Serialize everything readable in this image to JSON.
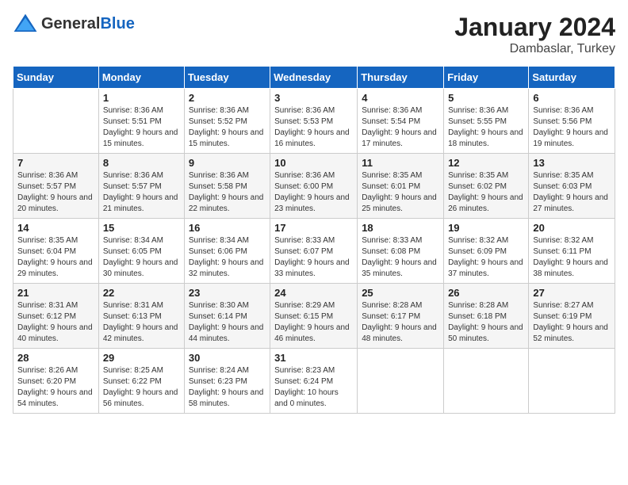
{
  "header": {
    "logo_general": "General",
    "logo_blue": "Blue",
    "month_title": "January 2024",
    "location": "Dambaslar, Turkey"
  },
  "days_of_week": [
    "Sunday",
    "Monday",
    "Tuesday",
    "Wednesday",
    "Thursday",
    "Friday",
    "Saturday"
  ],
  "weeks": [
    [
      {
        "day": "",
        "sunrise": "",
        "sunset": "",
        "daylight": ""
      },
      {
        "day": "1",
        "sunrise": "Sunrise: 8:36 AM",
        "sunset": "Sunset: 5:51 PM",
        "daylight": "Daylight: 9 hours and 15 minutes."
      },
      {
        "day": "2",
        "sunrise": "Sunrise: 8:36 AM",
        "sunset": "Sunset: 5:52 PM",
        "daylight": "Daylight: 9 hours and 15 minutes."
      },
      {
        "day": "3",
        "sunrise": "Sunrise: 8:36 AM",
        "sunset": "Sunset: 5:53 PM",
        "daylight": "Daylight: 9 hours and 16 minutes."
      },
      {
        "day": "4",
        "sunrise": "Sunrise: 8:36 AM",
        "sunset": "Sunset: 5:54 PM",
        "daylight": "Daylight: 9 hours and 17 minutes."
      },
      {
        "day": "5",
        "sunrise": "Sunrise: 8:36 AM",
        "sunset": "Sunset: 5:55 PM",
        "daylight": "Daylight: 9 hours and 18 minutes."
      },
      {
        "day": "6",
        "sunrise": "Sunrise: 8:36 AM",
        "sunset": "Sunset: 5:56 PM",
        "daylight": "Daylight: 9 hours and 19 minutes."
      }
    ],
    [
      {
        "day": "7",
        "sunrise": "Sunrise: 8:36 AM",
        "sunset": "Sunset: 5:57 PM",
        "daylight": "Daylight: 9 hours and 20 minutes."
      },
      {
        "day": "8",
        "sunrise": "Sunrise: 8:36 AM",
        "sunset": "Sunset: 5:57 PM",
        "daylight": "Daylight: 9 hours and 21 minutes."
      },
      {
        "day": "9",
        "sunrise": "Sunrise: 8:36 AM",
        "sunset": "Sunset: 5:58 PM",
        "daylight": "Daylight: 9 hours and 22 minutes."
      },
      {
        "day": "10",
        "sunrise": "Sunrise: 8:36 AM",
        "sunset": "Sunset: 6:00 PM",
        "daylight": "Daylight: 9 hours and 23 minutes."
      },
      {
        "day": "11",
        "sunrise": "Sunrise: 8:35 AM",
        "sunset": "Sunset: 6:01 PM",
        "daylight": "Daylight: 9 hours and 25 minutes."
      },
      {
        "day": "12",
        "sunrise": "Sunrise: 8:35 AM",
        "sunset": "Sunset: 6:02 PM",
        "daylight": "Daylight: 9 hours and 26 minutes."
      },
      {
        "day": "13",
        "sunrise": "Sunrise: 8:35 AM",
        "sunset": "Sunset: 6:03 PM",
        "daylight": "Daylight: 9 hours and 27 minutes."
      }
    ],
    [
      {
        "day": "14",
        "sunrise": "Sunrise: 8:35 AM",
        "sunset": "Sunset: 6:04 PM",
        "daylight": "Daylight: 9 hours and 29 minutes."
      },
      {
        "day": "15",
        "sunrise": "Sunrise: 8:34 AM",
        "sunset": "Sunset: 6:05 PM",
        "daylight": "Daylight: 9 hours and 30 minutes."
      },
      {
        "day": "16",
        "sunrise": "Sunrise: 8:34 AM",
        "sunset": "Sunset: 6:06 PM",
        "daylight": "Daylight: 9 hours and 32 minutes."
      },
      {
        "day": "17",
        "sunrise": "Sunrise: 8:33 AM",
        "sunset": "Sunset: 6:07 PM",
        "daylight": "Daylight: 9 hours and 33 minutes."
      },
      {
        "day": "18",
        "sunrise": "Sunrise: 8:33 AM",
        "sunset": "Sunset: 6:08 PM",
        "daylight": "Daylight: 9 hours and 35 minutes."
      },
      {
        "day": "19",
        "sunrise": "Sunrise: 8:32 AM",
        "sunset": "Sunset: 6:09 PM",
        "daylight": "Daylight: 9 hours and 37 minutes."
      },
      {
        "day": "20",
        "sunrise": "Sunrise: 8:32 AM",
        "sunset": "Sunset: 6:11 PM",
        "daylight": "Daylight: 9 hours and 38 minutes."
      }
    ],
    [
      {
        "day": "21",
        "sunrise": "Sunrise: 8:31 AM",
        "sunset": "Sunset: 6:12 PM",
        "daylight": "Daylight: 9 hours and 40 minutes."
      },
      {
        "day": "22",
        "sunrise": "Sunrise: 8:31 AM",
        "sunset": "Sunset: 6:13 PM",
        "daylight": "Daylight: 9 hours and 42 minutes."
      },
      {
        "day": "23",
        "sunrise": "Sunrise: 8:30 AM",
        "sunset": "Sunset: 6:14 PM",
        "daylight": "Daylight: 9 hours and 44 minutes."
      },
      {
        "day": "24",
        "sunrise": "Sunrise: 8:29 AM",
        "sunset": "Sunset: 6:15 PM",
        "daylight": "Daylight: 9 hours and 46 minutes."
      },
      {
        "day": "25",
        "sunrise": "Sunrise: 8:28 AM",
        "sunset": "Sunset: 6:17 PM",
        "daylight": "Daylight: 9 hours and 48 minutes."
      },
      {
        "day": "26",
        "sunrise": "Sunrise: 8:28 AM",
        "sunset": "Sunset: 6:18 PM",
        "daylight": "Daylight: 9 hours and 50 minutes."
      },
      {
        "day": "27",
        "sunrise": "Sunrise: 8:27 AM",
        "sunset": "Sunset: 6:19 PM",
        "daylight": "Daylight: 9 hours and 52 minutes."
      }
    ],
    [
      {
        "day": "28",
        "sunrise": "Sunrise: 8:26 AM",
        "sunset": "Sunset: 6:20 PM",
        "daylight": "Daylight: 9 hours and 54 minutes."
      },
      {
        "day": "29",
        "sunrise": "Sunrise: 8:25 AM",
        "sunset": "Sunset: 6:22 PM",
        "daylight": "Daylight: 9 hours and 56 minutes."
      },
      {
        "day": "30",
        "sunrise": "Sunrise: 8:24 AM",
        "sunset": "Sunset: 6:23 PM",
        "daylight": "Daylight: 9 hours and 58 minutes."
      },
      {
        "day": "31",
        "sunrise": "Sunrise: 8:23 AM",
        "sunset": "Sunset: 6:24 PM",
        "daylight": "Daylight: 10 hours and 0 minutes."
      },
      {
        "day": "",
        "sunrise": "",
        "sunset": "",
        "daylight": ""
      },
      {
        "day": "",
        "sunrise": "",
        "sunset": "",
        "daylight": ""
      },
      {
        "day": "",
        "sunrise": "",
        "sunset": "",
        "daylight": ""
      }
    ]
  ]
}
